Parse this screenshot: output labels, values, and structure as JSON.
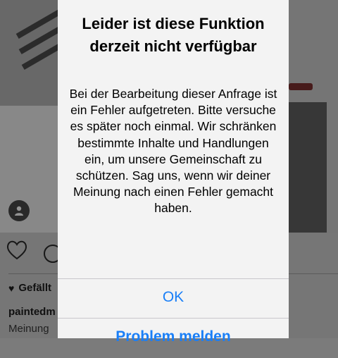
{
  "post": {
    "likes_label": "Gefällt",
    "username": "paintedm",
    "caption": "Meinung"
  },
  "alert": {
    "title": "Leider ist diese Funktion derzeit nicht verfügbar",
    "message": "Bei der Bearbeitung dieser Anfrage ist ein Fehler aufgetreten. Bitte versuche es später noch einmal. Wir schränken bestimmte Inhalte und Handlungen ein, um unsere Gemeinschaft zu schützen. Sag uns, wenn wir deiner Meinung nach einen Fehler gemacht haben.",
    "ok_label": "OK",
    "report_label": "Problem melden"
  },
  "colors": {
    "accent": "#1a7ff7",
    "alert_background": "#f3f3f3"
  },
  "icons": {
    "heart": "heart-icon",
    "comment": "comment-icon",
    "person": "person-icon"
  }
}
